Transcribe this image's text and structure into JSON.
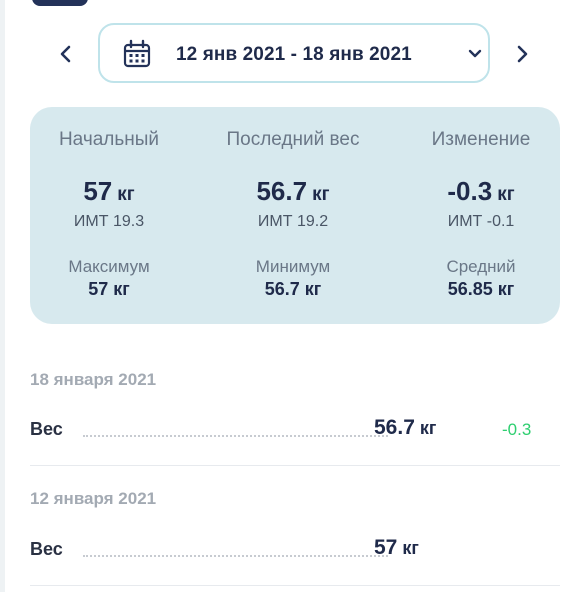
{
  "date_selector": {
    "range_label": "12 янв 2021 - 18 янв 2021"
  },
  "summary": {
    "starting": {
      "title": "Начальный",
      "value": "57",
      "unit": "кг",
      "bmi": "ИМТ 19.3"
    },
    "latest": {
      "title": "Последний вес",
      "value": "56.7",
      "unit": "кг",
      "bmi": "ИМТ 19.2"
    },
    "change": {
      "title": "Изменение",
      "value": "-0.3",
      "unit": "кг",
      "bmi": "ИМТ -0.1"
    },
    "maximum": {
      "title": "Максимум",
      "value": "57 кг"
    },
    "minimum": {
      "title": "Минимум",
      "value": "56.7 кг"
    },
    "average": {
      "title": "Средний",
      "value": "56.85 кг"
    }
  },
  "entries": [
    {
      "date": "18 января 2021",
      "label": "Вес",
      "value": "56.7",
      "unit": "кг",
      "change": "-0.3"
    },
    {
      "date": "12 января 2021",
      "label": "Вес",
      "value": "57",
      "unit": "кг",
      "change": ""
    }
  ],
  "colors": {
    "accent": "#233259",
    "card_background": "#d7e9ee",
    "date_border": "#bfe3ea",
    "change_positive": "#2ecf70"
  }
}
